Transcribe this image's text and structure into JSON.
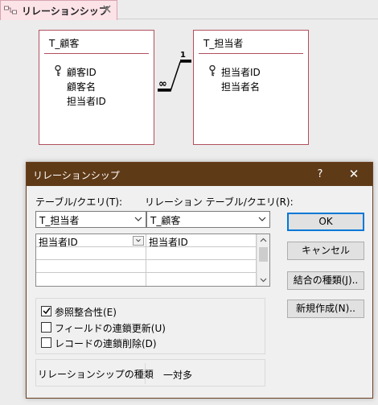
{
  "document_tab": {
    "label": "リレーションシップ",
    "close_glyph": "✕"
  },
  "tables": [
    {
      "title": "T_顧客",
      "fields": [
        {
          "name": "顧客ID",
          "key": true
        },
        {
          "name": "顧客名",
          "key": false
        },
        {
          "name": "担当者ID",
          "key": false
        }
      ]
    },
    {
      "title": "T_担当者",
      "fields": [
        {
          "name": "担当者ID",
          "key": true
        },
        {
          "name": "担当者名",
          "key": false
        }
      ]
    }
  ],
  "relationship_line": {
    "one_label": "1",
    "many_label": "∞"
  },
  "dialog": {
    "title": "リレーションシップ",
    "help_glyph": "?",
    "close_glyph": "✕",
    "table_label": "テーブル/クエリ(T):",
    "related_table_label": "リレーション テーブル/クエリ(R):",
    "table_value": "T_担当者",
    "related_table_value": "T_顧客",
    "field_rows": [
      {
        "left": "担当者ID",
        "right": "担当者ID"
      },
      {
        "left": "",
        "right": ""
      },
      {
        "left": "",
        "right": ""
      },
      {
        "left": "",
        "right": ""
      }
    ],
    "buttons": {
      "ok": "OK",
      "cancel": "キャンセル",
      "join_type": "結合の種類(J)..",
      "create_new": "新規作成(N).."
    },
    "checkboxes": [
      {
        "label": "参照整合性(E)",
        "checked": true
      },
      {
        "label": "フィールドの連鎖更新(U)",
        "checked": false
      },
      {
        "label": "レコードの連鎖削除(D)",
        "checked": false
      }
    ],
    "relationship_type_label": "リレーションシップの種類",
    "relationship_type_value": "一対多"
  },
  "colors": {
    "accent_tab": "#fbe3e8",
    "table_border": "#b0505e",
    "titlebar": "#5f3a17",
    "default_button_border": "#0078d7"
  }
}
